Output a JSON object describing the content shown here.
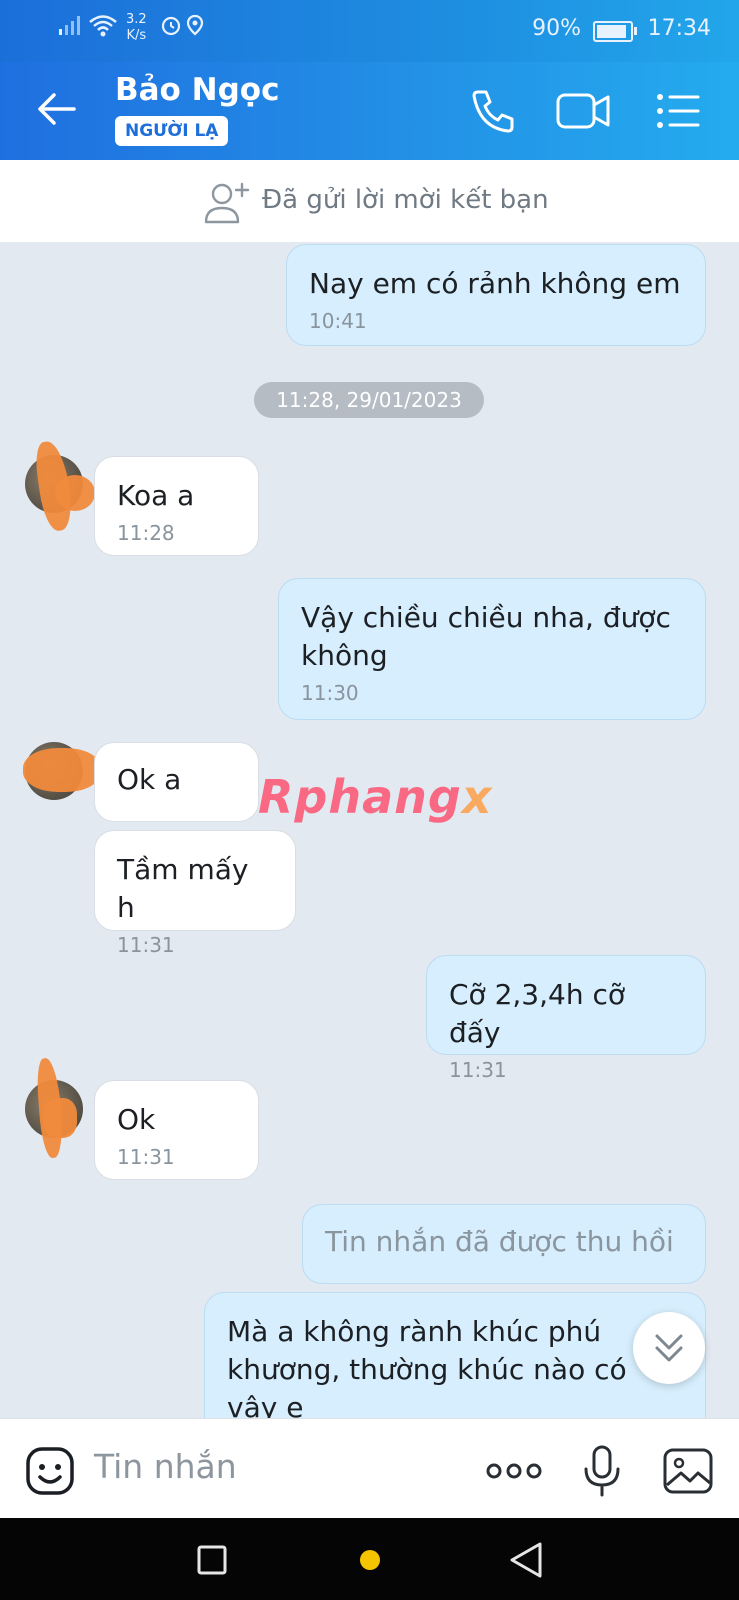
{
  "status_bar": {
    "net_speed_value": "3.2",
    "net_speed_unit": "K/s",
    "battery_percent": "90%",
    "battery_level": 0.9,
    "time": "17:34"
  },
  "header": {
    "contact_name": "Bảo Ngọc",
    "badge": "NGƯỜI LẠ"
  },
  "friend_request": {
    "text": "Đã gửi lời mời kết bạn"
  },
  "messages": [
    {
      "dir": "out",
      "text": "Nay em có rảnh không em",
      "time": "10:41"
    },
    {
      "dir": "in",
      "text": "Koa a",
      "time": "11:28"
    },
    {
      "dir": "out",
      "text": "Vậy chiều chiều nha, được không",
      "time": "11:30"
    },
    {
      "dir": "in",
      "text": "Ok a",
      "time": ""
    },
    {
      "dir": "in",
      "text": "Tầm mấy h",
      "time": "11:31"
    },
    {
      "dir": "out",
      "text": "Cỡ 2,3,4h cỡ đấy",
      "time": "11:31"
    },
    {
      "dir": "in",
      "text": "Ok",
      "time": "11:31"
    },
    {
      "dir": "out",
      "text": "Tin nhắn đã được thu hồi",
      "time": ""
    },
    {
      "dir": "out",
      "text": "Mà a không rành khúc phú khương, thường khúc nào có vậy e",
      "time": ""
    }
  ],
  "date_separator": "11:28, 29/01/2023",
  "watermark": {
    "main": "Rphang",
    "accent": "x"
  },
  "input": {
    "placeholder": "Tin nhắn"
  },
  "colors": {
    "header_blue": "#1f7fe3",
    "outgoing_bubble": "#d6eefd",
    "incoming_bubble": "#ffffff",
    "chat_background": "#e2e9f1"
  },
  "icons": [
    "back-arrow-icon",
    "phone-icon",
    "video-call-icon",
    "menu-list-icon",
    "add-friend-icon",
    "sticker-icon",
    "more-dots-icon",
    "microphone-icon",
    "image-icon",
    "scroll-down-icon",
    "nav-square-icon",
    "nav-home-dot-icon",
    "nav-back-triangle-icon"
  ]
}
